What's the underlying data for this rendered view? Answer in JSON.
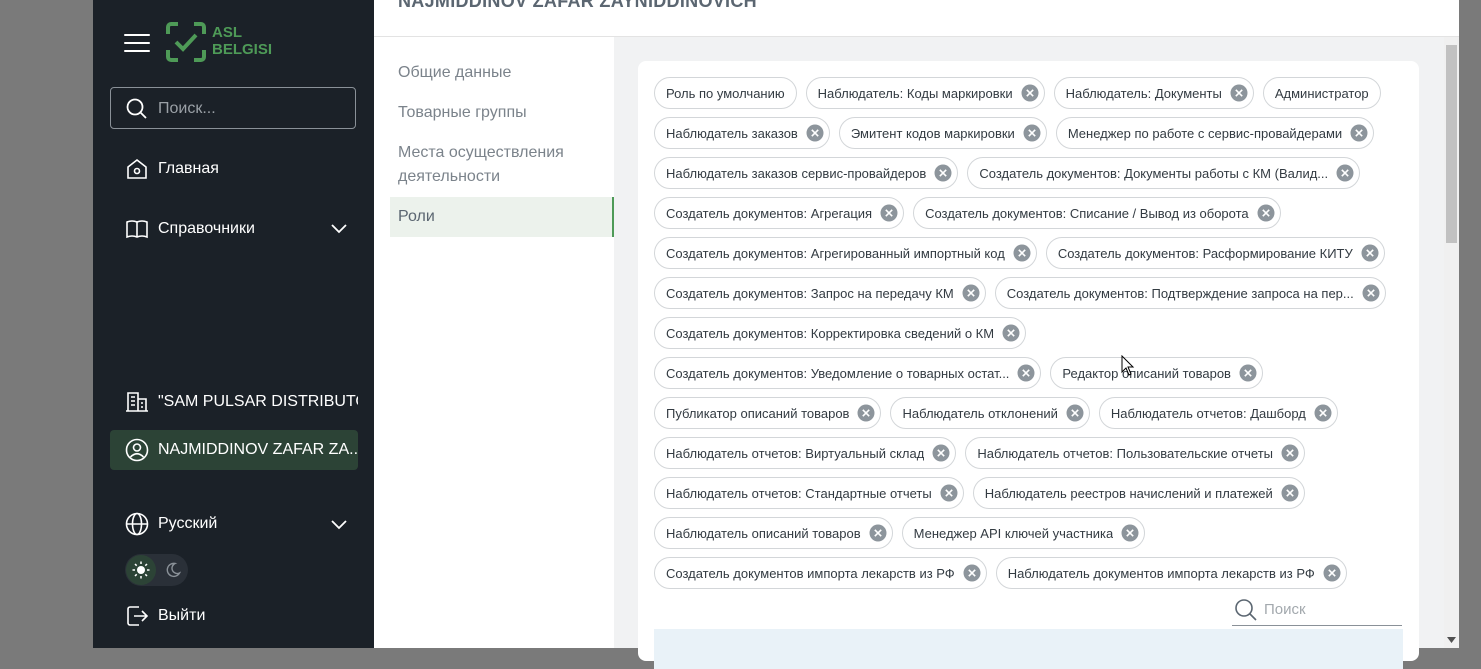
{
  "app": {
    "brand_line1": "ASL",
    "brand_line2": "BELGISI",
    "colors": {
      "sidebar_bg": "#1b2128",
      "accent_green": "#4e9a57",
      "active_bg": "#2c4336"
    }
  },
  "sidebar": {
    "search_placeholder": "Поиск...",
    "nav": [
      {
        "label": "Главная",
        "icon": "home-icon"
      },
      {
        "label": "Справочники",
        "icon": "book-icon"
      }
    ],
    "org_label": "\"SAM PULSAR DISTRIBUTO...",
    "user_label": "NAJMIDDINOV ZAFAR ZA...",
    "language": "Русский",
    "logout": "Выйти"
  },
  "header": {
    "title": "NAJMIDDINOV ZAFAR ZAYNIDDINOVICH"
  },
  "subnav": {
    "items": [
      "Общие данные",
      "Товарные группы",
      "Места осуществления деятельности",
      "Роли"
    ],
    "active_index": 3
  },
  "roles": {
    "rows": [
      [
        {
          "label": "Роль по умолчанию",
          "removable": false
        },
        {
          "label": "Наблюдатель: Коды маркировки",
          "removable": true
        },
        {
          "label": "Наблюдатель: Документы",
          "removable": true
        },
        {
          "label": "Администратор",
          "removable": false
        }
      ],
      [
        {
          "label": "Наблюдатель заказов",
          "removable": true
        },
        {
          "label": "Эмитент кодов маркировки",
          "removable": true
        },
        {
          "label": "Менеджер по работе с сервис-провайдерами",
          "removable": true
        }
      ],
      [
        {
          "label": "Наблюдатель заказов сервис-провайдеров",
          "removable": true
        },
        {
          "label": "Создатель документов: Документы работы с КМ (Валид...",
          "removable": true
        }
      ],
      [
        {
          "label": "Создатель документов: Агрегация",
          "removable": true
        },
        {
          "label": "Создатель документов: Списание / Вывод из оборота",
          "removable": true
        }
      ],
      [
        {
          "label": "Создатель документов: Агрегированный импортный код",
          "removable": true
        },
        {
          "label": "Создатель документов: Расформирование КИТУ",
          "removable": true
        }
      ],
      [
        {
          "label": "Создатель документов: Запрос на передачу КМ",
          "removable": true
        },
        {
          "label": "Создатель документов: Подтверждение запроса на пер...",
          "removable": true
        }
      ],
      [
        {
          "label": "Создатель документов: Корректировка сведений о КМ",
          "removable": true
        }
      ],
      [
        {
          "label": "Создатель документов: Уведомление о товарных остат...",
          "removable": true
        },
        {
          "label": "Редактор описаний товаров",
          "removable": true
        }
      ],
      [
        {
          "label": "Публикатор описаний товаров",
          "removable": true
        },
        {
          "label": "Наблюдатель отклонений",
          "removable": true
        },
        {
          "label": "Наблюдатель отчетов: Дашборд",
          "removable": true
        }
      ],
      [
        {
          "label": "Наблюдатель отчетов: Виртуальный склад",
          "removable": true
        },
        {
          "label": "Наблюдатель отчетов: Пользовательские отчеты",
          "removable": true
        }
      ],
      [
        {
          "label": "Наблюдатель отчетов: Стандартные отчеты",
          "removable": true
        },
        {
          "label": "Наблюдатель реестров начислений и платежей",
          "removable": true
        }
      ],
      [
        {
          "label": "Наблюдатель описаний товаров",
          "removable": true
        },
        {
          "label": "Менеджер API ключей участника",
          "removable": true
        }
      ],
      [
        {
          "label": "Создатель документов импорта лекарств из РФ",
          "removable": true
        },
        {
          "label": "Наблюдатель документов импорта лекарств из РФ",
          "removable": true
        }
      ]
    ],
    "search_placeholder": "Поиск"
  }
}
